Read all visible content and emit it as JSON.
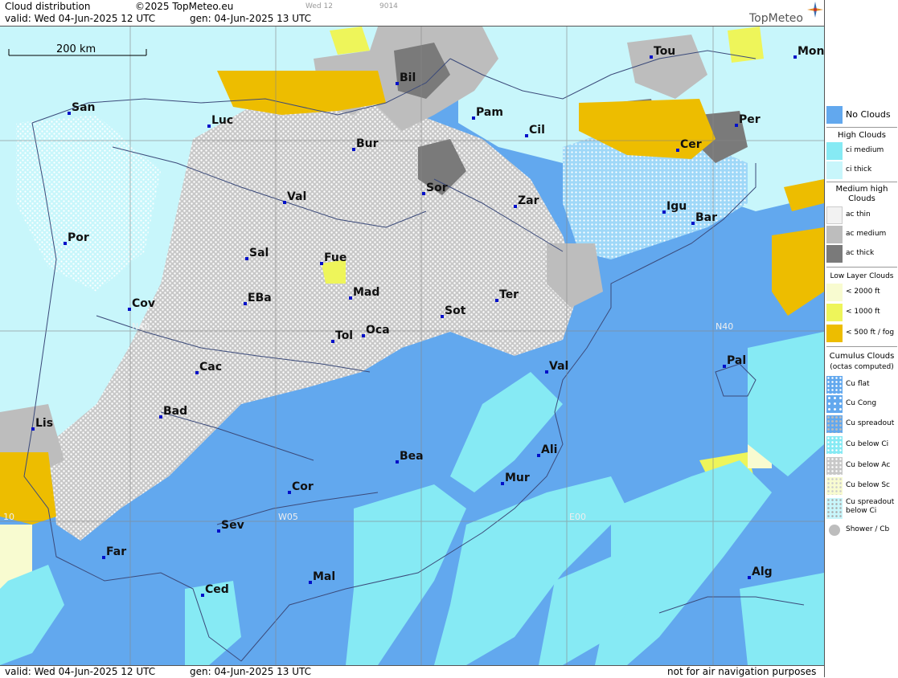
{
  "header": {
    "title": "Cloud distribution",
    "copyright": "©2025 TopMeteo.eu",
    "valid_line": "valid:  Wed  04-Jun-2025  12 UTC",
    "gen_line": "gen: 04-Jun-2025 13 UTC",
    "run_tag": "Wed 12",
    "code_tag": "9014",
    "brand": "TopMeteo"
  },
  "scale_bar": {
    "label": "200 km"
  },
  "footer": {
    "valid_line": "valid:  Wed  04-Jun-2025  12 UTC",
    "gen_line": "gen: 04-Jun-2025 13 UTC",
    "disclaimer": "not for air navigation purposes"
  },
  "grid_labels": {
    "n40_left": "N40",
    "n40_right": "N40",
    "w05": "W05",
    "e00": "E00",
    "w10": "10"
  },
  "cities": [
    {
      "name": "Tou"
    },
    {
      "name": "Mon"
    },
    {
      "name": "Bil"
    },
    {
      "name": "San"
    },
    {
      "name": "Pam"
    },
    {
      "name": "Luc"
    },
    {
      "name": "Cil"
    },
    {
      "name": "Per"
    },
    {
      "name": "Bur"
    },
    {
      "name": "Cer"
    },
    {
      "name": "Sor"
    },
    {
      "name": "Val"
    },
    {
      "name": "Zar"
    },
    {
      "name": "Igu"
    },
    {
      "name": "Bar"
    },
    {
      "name": "Por"
    },
    {
      "name": "Sal"
    },
    {
      "name": "Fue"
    },
    {
      "name": "Mad"
    },
    {
      "name": "Cov"
    },
    {
      "name": "EBa"
    },
    {
      "name": "Ter"
    },
    {
      "name": "Sot"
    },
    {
      "name": "Tol"
    },
    {
      "name": "Oca"
    },
    {
      "name": "Cac"
    },
    {
      "name": "Val"
    },
    {
      "name": "Pal"
    },
    {
      "name": "Bad"
    },
    {
      "name": "Lis"
    },
    {
      "name": "Bea"
    },
    {
      "name": "Ali"
    },
    {
      "name": "Cor"
    },
    {
      "name": "Mur"
    },
    {
      "name": "Sev"
    },
    {
      "name": "Far"
    },
    {
      "name": "Ced"
    },
    {
      "name": "Mal"
    },
    {
      "name": "Alg"
    }
  ],
  "legend": {
    "no_clouds": "No Clouds",
    "high_clouds": "High Clouds",
    "ci_medium": "ci medium",
    "ci_thick": "ci thick",
    "medium_high": "Medium high Clouds",
    "ac_thin": "ac thin",
    "ac_medium": "ac medium",
    "ac_thick": "ac thick",
    "low_layer": "Low Layer Clouds",
    "low_2000": "< 2000 ft",
    "low_1000": "< 1000 ft",
    "low_500": "< 500 ft / fog",
    "cumulus": "Cumulus Clouds",
    "cumulus_sub": "(octas computed)",
    "cu_flat": "Cu flat",
    "cu_cong": "Cu Cong",
    "cu_spreadout": "Cu spreadout",
    "cu_below_ci": "Cu below Ci",
    "cu_below_ac": "Cu below Ac",
    "cu_below_sc": "Cu below Sc",
    "cu_spreadout_below_ci": "Cu spreadout below Ci",
    "shower_cb": "Shower / Cb"
  },
  "colors": {
    "no_clouds": "#62a8ee",
    "ci_medium": "#86eaf4",
    "ci_thick": "#c8f6fb",
    "ac_thin": "#f2f2f2",
    "ac_medium": "#bdbdbd",
    "ac_thick": "#7a7a7a",
    "low_2000": "#f8fbd0",
    "low_1000": "#eef55a",
    "low_500": "#edbd00"
  }
}
